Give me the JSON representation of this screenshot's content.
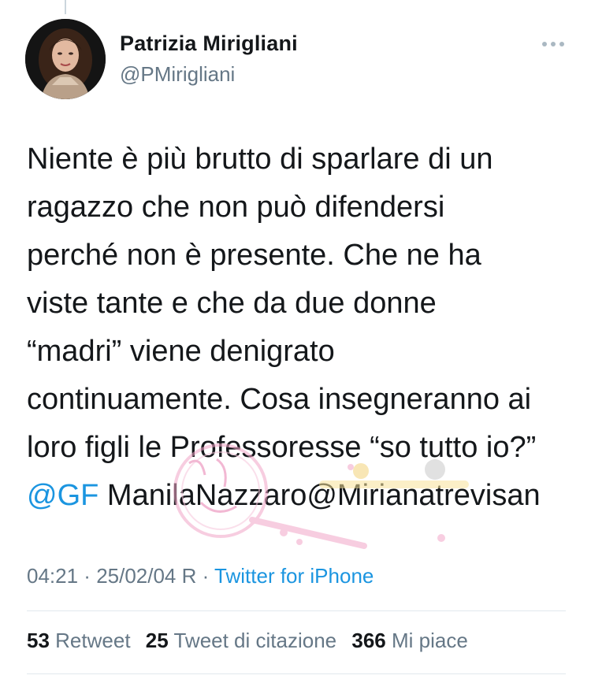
{
  "author": {
    "name": "Patrizia Mirigliani",
    "handle": "@PMirigliani",
    "avatar_icon": "profile-photo"
  },
  "more_icon": "ellipsis-icon",
  "tweet": {
    "lines": [
      "Niente è più brutto di sparlare di un",
      "ragazzo che non può difendersi",
      "perché non è presente. Che ne ha",
      "viste tante e che da due donne",
      "“madri” viene denigrato",
      "continuamente. Cosa insegneranno ai",
      "loro figli le Professoresse “so tutto io?”"
    ],
    "mention_line": {
      "mention1": "@GF",
      "rest": "ManilaNazzaro@Mirianatrevisan"
    }
  },
  "meta": {
    "time": "04:21",
    "sep1": " · ",
    "date": "25/02/04 R",
    "sep2": " · ",
    "source": "Twitter for iPhone"
  },
  "stats": {
    "retweets_count": "53",
    "retweets_label": "Retweet",
    "quotes_count": "25",
    "quotes_label": "Tweet di citazione",
    "likes_count": "366",
    "likes_label": "Mi piace"
  },
  "colors": {
    "link": "#1b95e0",
    "secondary_text": "#657786",
    "primary_text": "#14171a"
  }
}
